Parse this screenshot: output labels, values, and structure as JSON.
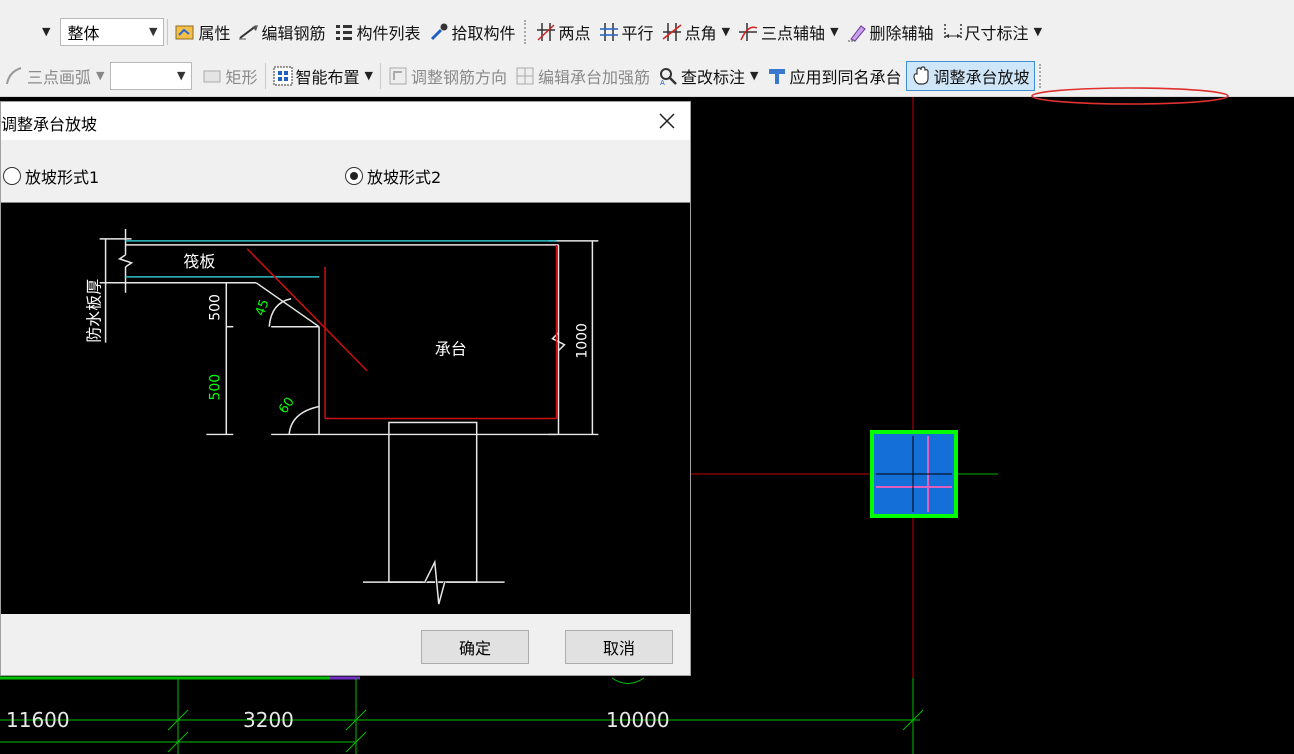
{
  "toolbar_row1": {
    "scope_combo": "整体",
    "items": [
      {
        "id": "properties",
        "label": "属性",
        "icon": "properties-icon"
      },
      {
        "id": "edit-rebar",
        "label": "编辑钢筋",
        "icon": "edit-rebar-icon"
      },
      {
        "id": "component-list",
        "label": "构件列表",
        "icon": "list-icon"
      },
      {
        "id": "pick-component",
        "label": "拾取构件",
        "icon": "eyedropper-icon"
      },
      {
        "id": "two-points",
        "label": "两点",
        "icon": "two-point-axis-icon"
      },
      {
        "id": "parallel",
        "label": "平行",
        "icon": "parallel-axis-icon"
      },
      {
        "id": "point-angle",
        "label": "点角",
        "icon": "point-angle-icon"
      },
      {
        "id": "three-point-axis",
        "label": "三点辅轴",
        "icon": "three-point-axis-icon"
      },
      {
        "id": "delete-axis",
        "label": "删除辅轴",
        "icon": "eraser-icon"
      },
      {
        "id": "dimension",
        "label": "尺寸标注",
        "icon": "dimension-icon"
      }
    ]
  },
  "toolbar_row2": {
    "items": [
      {
        "id": "three-point-arc",
        "label": "三点画弧",
        "icon": "arc-icon"
      },
      {
        "id": "rectangle",
        "label": "矩形",
        "icon": "rectangle-icon"
      },
      {
        "id": "smart-layout",
        "label": "智能布置",
        "icon": "smart-layout-icon"
      },
      {
        "id": "adjust-rebar-direction",
        "label": "调整钢筋方向",
        "icon": "rebar-direction-icon"
      },
      {
        "id": "edit-cap-reinforcement",
        "label": "编辑承台加强筋",
        "icon": "cap-reinforcement-icon"
      },
      {
        "id": "check-annotation",
        "label": "查改标注",
        "icon": "check-annotation-icon"
      },
      {
        "id": "apply-same-name",
        "label": "应用到同名承台",
        "icon": "apply-icon"
      },
      {
        "id": "adjust-cap-slope",
        "label": "调整承台放坡",
        "icon": "hand-icon"
      }
    ]
  },
  "dialog": {
    "title": "调整承台放坡",
    "radio1": "放坡形式1",
    "radio2": "放坡形式2",
    "selected": 2,
    "diagram": {
      "raft_label": "筏板",
      "waterproof_label": "防水板厚",
      "cap_label": "承台",
      "dim_top": "500",
      "dim_bottom": "500",
      "dim_right": "1000",
      "angle_top": "45",
      "angle_bottom": "60"
    },
    "ok": "确定",
    "cancel": "取消"
  },
  "canvas": {
    "dim1": "11600",
    "dim2": "3200",
    "dim3": "10000"
  },
  "colors": {
    "dialog_green": "#00e000",
    "cap_fill": "#1470d8",
    "cap_border": "#00ff00",
    "axis_red": "#d40000",
    "highlight_oval": "#e03030"
  }
}
